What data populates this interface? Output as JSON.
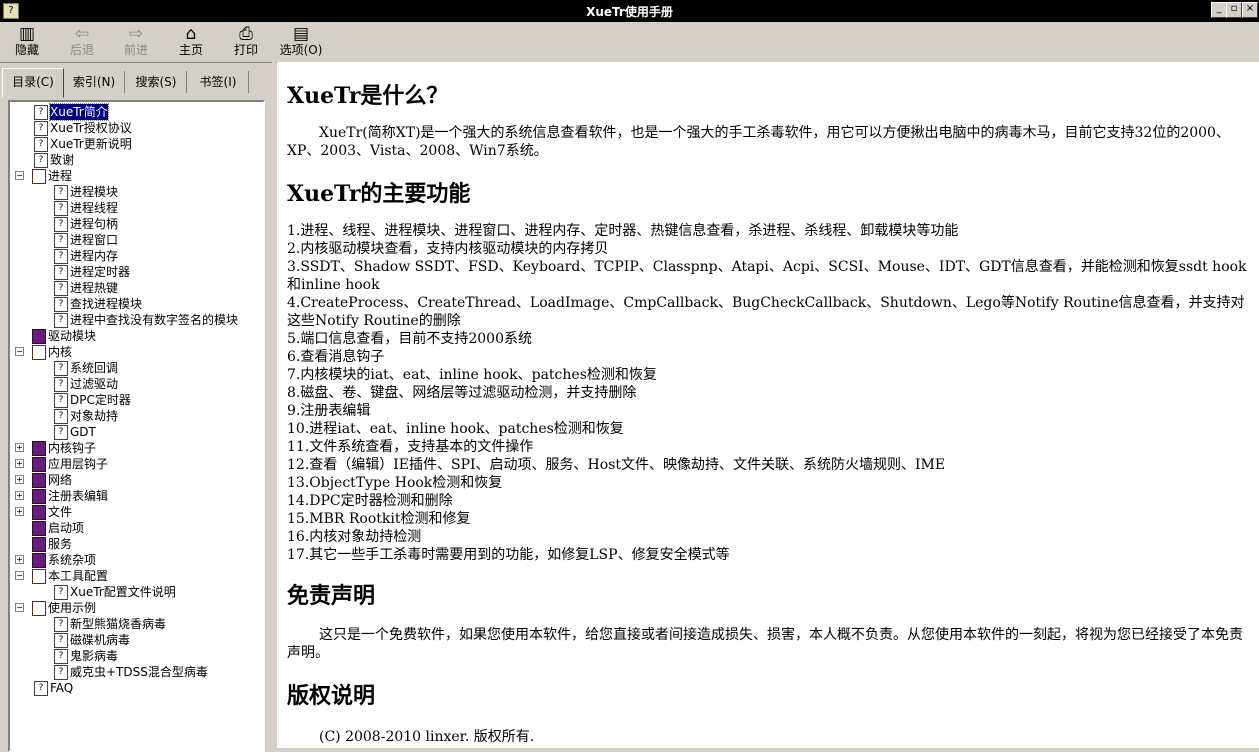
{
  "window": {
    "title": "XueTr使用手册"
  },
  "toolbar": [
    {
      "icon": "hide-icon",
      "label": "隐藏",
      "enabled": true
    },
    {
      "icon": "back-icon",
      "label": "后退",
      "enabled": false
    },
    {
      "icon": "forward-icon",
      "label": "前进",
      "enabled": false
    },
    {
      "icon": "home-icon",
      "label": "主页",
      "enabled": true
    },
    {
      "icon": "printer-icon",
      "label": "打印",
      "enabled": true
    },
    {
      "icon": "options-icon",
      "label": "选项(O)",
      "enabled": true
    }
  ],
  "tabs": [
    "目录(C)",
    "索引(N)",
    "搜索(S)",
    "书签(I)"
  ],
  "tree": [
    {
      "label": "XueTr简介",
      "level": 1,
      "type": "page",
      "selected": true
    },
    {
      "label": "XueTr授权协议",
      "level": 1,
      "type": "page"
    },
    {
      "label": "XueTr更新说明",
      "level": 1,
      "type": "page"
    },
    {
      "label": "致谢",
      "level": 1,
      "type": "page"
    },
    {
      "label": "进程",
      "level": 0,
      "type": "book-open",
      "toggle": "−"
    },
    {
      "label": "进程模块",
      "level": 2,
      "type": "page"
    },
    {
      "label": "进程线程",
      "level": 2,
      "type": "page"
    },
    {
      "label": "进程句柄",
      "level": 2,
      "type": "page"
    },
    {
      "label": "进程窗口",
      "level": 2,
      "type": "page"
    },
    {
      "label": "进程内存",
      "level": 2,
      "type": "page"
    },
    {
      "label": "进程定时器",
      "level": 2,
      "type": "page"
    },
    {
      "label": "进程热键",
      "level": 2,
      "type": "page"
    },
    {
      "label": "查找进程模块",
      "level": 2,
      "type": "page"
    },
    {
      "label": "进程中查找没有数字签名的模块",
      "level": 2,
      "type": "page"
    },
    {
      "label": "驱动模块",
      "level": 0,
      "type": "book-closed"
    },
    {
      "label": "内核",
      "level": 0,
      "type": "book-open",
      "toggle": "−"
    },
    {
      "label": "系统回调",
      "level": 2,
      "type": "page"
    },
    {
      "label": "过滤驱动",
      "level": 2,
      "type": "page"
    },
    {
      "label": "DPC定时器",
      "level": 2,
      "type": "page"
    },
    {
      "label": "对象劫持",
      "level": 2,
      "type": "page"
    },
    {
      "label": "GDT",
      "level": 2,
      "type": "page"
    },
    {
      "label": "内核钩子",
      "level": 0,
      "type": "book-closed",
      "toggle": "+"
    },
    {
      "label": "应用层钩子",
      "level": 0,
      "type": "book-closed",
      "toggle": "+"
    },
    {
      "label": "网络",
      "level": 0,
      "type": "book-closed",
      "toggle": "+"
    },
    {
      "label": "注册表编辑",
      "level": 0,
      "type": "book-closed",
      "toggle": "+"
    },
    {
      "label": "文件",
      "level": 0,
      "type": "book-closed",
      "toggle": "+"
    },
    {
      "label": "启动项",
      "level": 0,
      "type": "book-closed"
    },
    {
      "label": "服务",
      "level": 0,
      "type": "book-closed"
    },
    {
      "label": "系统杂项",
      "level": 0,
      "type": "book-closed",
      "toggle": "+"
    },
    {
      "label": "本工具配置",
      "level": 0,
      "type": "book-open",
      "toggle": "−"
    },
    {
      "label": "XueTr配置文件说明",
      "level": 2,
      "type": "page"
    },
    {
      "label": "使用示例",
      "level": 0,
      "type": "book-open",
      "toggle": "−"
    },
    {
      "label": "新型熊猫烧香病毒",
      "level": 2,
      "type": "page"
    },
    {
      "label": "磁碟机病毒",
      "level": 2,
      "type": "page"
    },
    {
      "label": "鬼影病毒",
      "level": 2,
      "type": "page"
    },
    {
      "label": "威克虫+TDSS混合型病毒",
      "level": 2,
      "type": "page"
    },
    {
      "label": "FAQ",
      "level": 1,
      "type": "page"
    }
  ],
  "content": {
    "h1": "XueTr是什么？",
    "p1": "XueTr(简称XT)是一个强大的系统信息查看软件，也是一个强大的手工杀毒软件，用它可以方便揪出电脑中的病毒木马，目前它支持32位的2000、XP、2003、Vista、2008、Win7系统。",
    "h2": "XueTr的主要功能",
    "features": [
      "1.进程、线程、进程模块、进程窗口、进程内存、定时器、热键信息查看，杀进程、杀线程、卸载模块等功能",
      "2.内核驱动模块查看，支持内核驱动模块的内存拷贝",
      "3.SSDT、Shadow SSDT、FSD、Keyboard、TCPIP、Classpnp、Atapi、Acpi、SCSI、Mouse、IDT、GDT信息查看，并能检测和恢复ssdt hook和inline hook",
      "4.CreateProcess、CreateThread、LoadImage、CmpCallback、BugCheckCallback、Shutdown、Lego等Notify Routine信息查看，并支持对这些Notify Routine的删除",
      "5.端口信息查看，目前不支持2000系统",
      "6.查看消息钩子",
      "7.内核模块的iat、eat、inline hook、patches检测和恢复",
      "8.磁盘、卷、键盘、网络层等过滤驱动检测，并支持删除",
      "9.注册表编辑",
      "10.进程iat、eat、inline hook、patches检测和恢复",
      "11.文件系统查看，支持基本的文件操作",
      "12.查看（编辑）IE插件、SPI、启动项、服务、Host文件、映像劫持、文件关联、系统防火墙规则、IME",
      "13.ObjectType Hook检测和恢复",
      "14.DPC定时器检测和删除",
      "15.MBR Rootkit检测和修复",
      "16.内核对象劫持检测",
      "17.其它一些手工杀毒时需要用到的功能，如修复LSP、修复安全模式等"
    ],
    "h3": "免责声明",
    "p2": "这只是一个免费软件，如果您使用本软件，给您直接或者间接造成损失、损害，本人概不负责。从您使用本软件的一刻起，将视为您已经接受了本免责声明。",
    "h4": "版权说明",
    "p3": "(C) 2008-2010 linxer. 版权所有."
  }
}
